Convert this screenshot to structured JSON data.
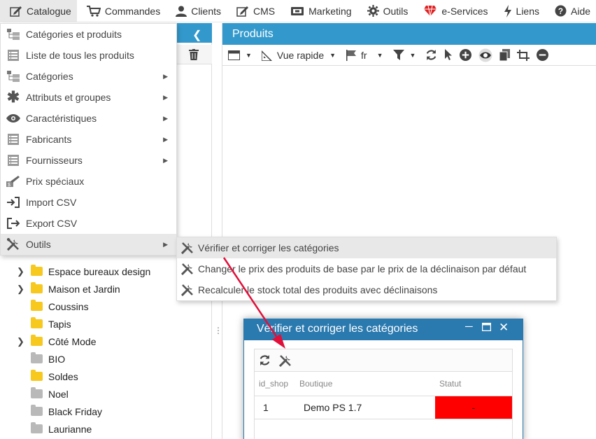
{
  "topbar": {
    "items": [
      {
        "label": "Catalogue",
        "icon": "edit-icon"
      },
      {
        "label": "Commandes",
        "icon": "cart-icon"
      },
      {
        "label": "Clients",
        "icon": "user-icon"
      },
      {
        "label": "CMS",
        "icon": "edit-icon"
      },
      {
        "label": "Marketing",
        "icon": "ticket-icon"
      },
      {
        "label": "Outils",
        "icon": "gear-icon"
      },
      {
        "label": "e-Services",
        "icon": "gem-icon"
      },
      {
        "label": "Liens",
        "icon": "bolt-icon"
      },
      {
        "label": "Aide",
        "icon": "help-icon"
      }
    ]
  },
  "catalogue_menu": {
    "items": [
      {
        "label": "Catégories et produits",
        "icon": "tree-icon",
        "has_sub": false
      },
      {
        "label": "Liste de tous les produits",
        "icon": "list-icon",
        "has_sub": false
      },
      {
        "label": "Catégories",
        "icon": "tree-icon",
        "has_sub": true
      },
      {
        "label": "Attributs et groupes",
        "icon": "asterisk-icon",
        "has_sub": true
      },
      {
        "label": "Caractéristiques",
        "icon": "eye-icon",
        "has_sub": true
      },
      {
        "label": "Fabricants",
        "icon": "list-icon",
        "has_sub": true
      },
      {
        "label": "Fournisseurs",
        "icon": "list-icon",
        "has_sub": true
      },
      {
        "label": "Prix spéciaux",
        "icon": "price-icon",
        "has_sub": false
      },
      {
        "label": "Import CSV",
        "icon": "import-icon",
        "has_sub": false
      },
      {
        "label": "Export CSV",
        "icon": "export-icon",
        "has_sub": false
      },
      {
        "label": "Outils",
        "icon": "tools-icon",
        "has_sub": true
      }
    ]
  },
  "outils_submenu": {
    "items": [
      {
        "label": "Vérifier et corriger les catégories"
      },
      {
        "label": "Changer le prix des produits de base par le prix de la déclinaison par défaut"
      },
      {
        "label": "Recalculer le stock total des produits avec déclinaisons"
      }
    ]
  },
  "tree": {
    "items": [
      {
        "label": "Espace bureaux design",
        "expandable": true,
        "color": "yellow"
      },
      {
        "label": "Maison et Jardin",
        "expandable": true,
        "color": "yellow"
      },
      {
        "label": "Coussins",
        "expandable": false,
        "color": "yellow"
      },
      {
        "label": "Tapis",
        "expandable": false,
        "color": "yellow"
      },
      {
        "label": "Côté Mode",
        "expandable": true,
        "color": "yellow"
      },
      {
        "label": "BIO",
        "expandable": false,
        "color": "grey"
      },
      {
        "label": "Soldes",
        "expandable": false,
        "color": "yellow"
      },
      {
        "label": "Noel",
        "expandable": false,
        "color": "grey"
      },
      {
        "label": "Black Friday",
        "expandable": false,
        "color": "grey"
      },
      {
        "label": "Laurianne",
        "expandable": false,
        "color": "grey"
      }
    ]
  },
  "products_panel": {
    "title": "Produits",
    "view_label": "Vue rapide",
    "lang_label": "fr"
  },
  "dialog": {
    "title": "Vérifier et corriger les catégories",
    "columns": [
      "id_shop",
      "Boutique",
      "Statut"
    ],
    "rows": [
      {
        "id_shop": "1",
        "boutique": "Demo PS 1.7",
        "statut": "-"
      }
    ]
  },
  "colors": {
    "header_blue": "#3399cc",
    "dialog_blue": "#2b7aaf",
    "status_red": "#ff0000",
    "annotation_arrow": "#e0103a"
  }
}
